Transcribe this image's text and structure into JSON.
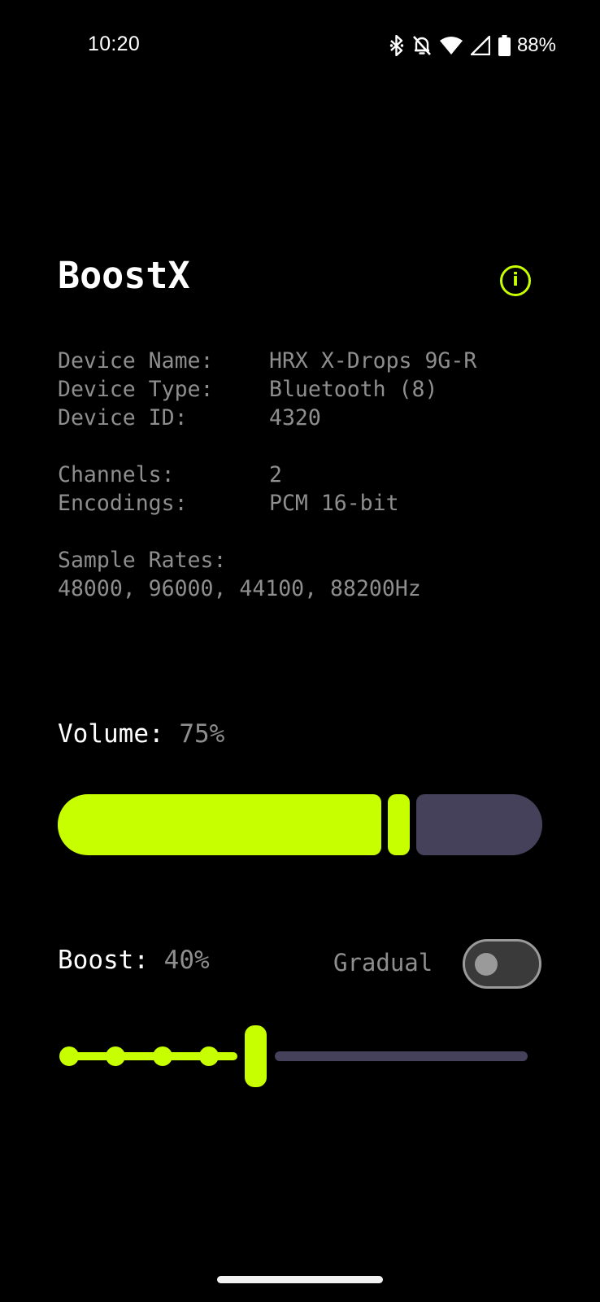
{
  "status_bar": {
    "time": "10:20",
    "battery_percent": "88%",
    "icons": [
      "bluetooth-icon",
      "notifications-off-icon",
      "wifi-icon",
      "cell-signal-icon",
      "battery-icon"
    ]
  },
  "app": {
    "title": "BoostX",
    "info_icon": "info-icon",
    "accent_color": "#c8ff00",
    "track_color": "#45415a"
  },
  "device_info": {
    "name_label": "Device Name:",
    "name_value": "HRX X-Drops 9G-R",
    "type_label": "Device Type:",
    "type_value": "Bluetooth (8)",
    "id_label": "Device ID:",
    "id_value": "4320",
    "channels_label": "Channels:",
    "channels_value": "2",
    "encodings_label": "Encodings:",
    "encodings_value": "PCM 16-bit",
    "sample_rates_label": "Sample Rates:",
    "sample_rates_value": "48000, 96000, 44100, 88200Hz"
  },
  "volume": {
    "label": "Volume:",
    "value_text": "75%",
    "level": 0.75
  },
  "boost": {
    "label": "Boost:",
    "value_text": "40%",
    "level": 0.4,
    "steps": 10,
    "gradual_label": "Gradual",
    "gradual_enabled": false
  }
}
